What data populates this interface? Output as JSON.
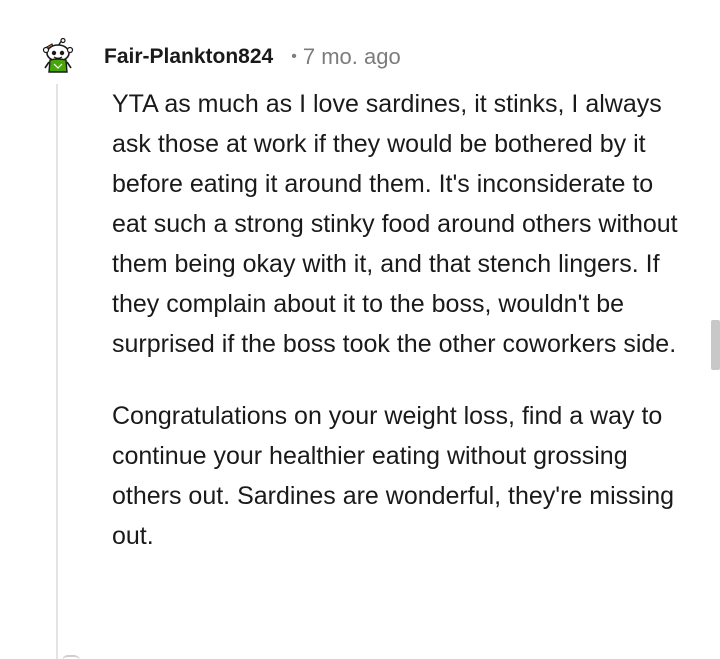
{
  "comment": {
    "author": "Fair-Plankton824",
    "separator": "•",
    "timestamp": "7 mo. ago",
    "avatar_icon": "snoo-avatar-icon",
    "paragraphs": [
      "YTA as much as I love sardines, it stinks, I always ask those at work if they would be bothered by it before eating it around them. It's inconsiderate to eat such a strong stinky food around others without them being okay with it, and that stench lingers. If they complain about it to the boss, wouldn't be surprised if the boss took the other coworkers side.",
      "Congratulations on your weight loss, find a way to continue your healthier eating without grossing others out. Sardines are wonderful, they're missing out."
    ]
  },
  "colors": {
    "text": "#1a1a1b",
    "meta": "#7c7c7c",
    "thread_line": "#e3e3e3",
    "scrollbar": "#c8c8c8",
    "avatar_accent": "#46a508"
  }
}
